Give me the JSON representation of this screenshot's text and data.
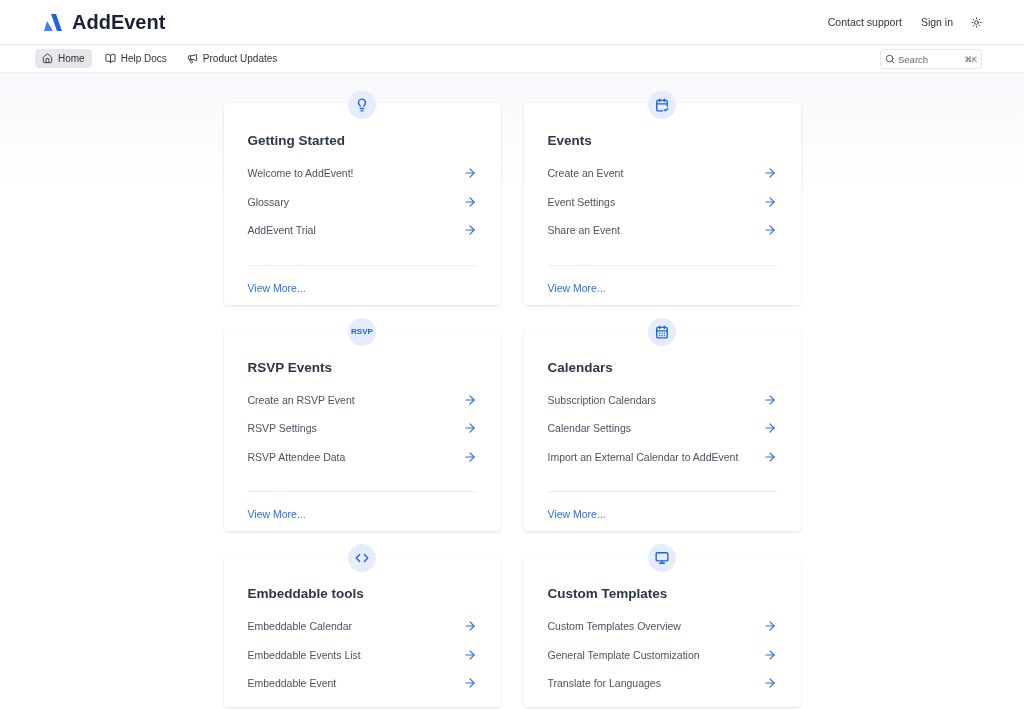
{
  "header": {
    "brand": "AddEvent",
    "links": [
      "Contact support",
      "Sign in"
    ]
  },
  "nav": {
    "items": [
      {
        "label": "Home",
        "kind": "home",
        "selected": true
      },
      {
        "label": "Help Docs",
        "kind": "docs",
        "selected": false
      },
      {
        "label": "Product Updates",
        "kind": "updates",
        "selected": false
      }
    ],
    "search": {
      "placeholder": "Search",
      "shortcut": "⌘K"
    }
  },
  "cards": [
    {
      "title": "Getting Started",
      "kind": "start",
      "items": [
        "Welcome to AddEvent!",
        "Glossary",
        "AddEvent Trial"
      ],
      "view_more": "View More..."
    },
    {
      "title": "Events",
      "kind": "event",
      "items": [
        "Create an Event",
        "Event Settings",
        "Share an Event"
      ],
      "view_more": "View More..."
    },
    {
      "title": "RSVP Events",
      "kind": "rsvp",
      "badge_text": "RSVP",
      "items": [
        "Create an RSVP Event",
        "RSVP Settings",
        "RSVP Attendee Data"
      ],
      "view_more": "View More..."
    },
    {
      "title": "Calendars",
      "kind": "calendars",
      "items": [
        "Subscription Calendars",
        "Calendar Settings",
        "Import an External Calendar to AddEvent"
      ],
      "view_more": "View More..."
    },
    {
      "title": "Embeddable tools",
      "kind": "embed",
      "items": [
        "Embeddable Calendar",
        "Embeddable Events List",
        "Embeddable Event"
      ]
    },
    {
      "title": "Custom Templates",
      "kind": "templates",
      "items": [
        "Custom Templates Overview",
        "General Template Customization",
        "Translate for Languages"
      ]
    }
  ]
}
